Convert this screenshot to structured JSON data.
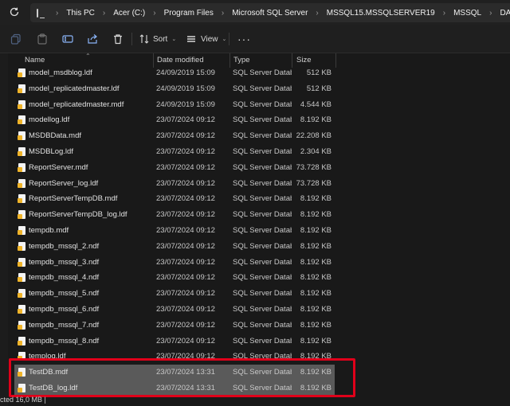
{
  "address_bar": {
    "crumbs": [
      "This PC",
      "Acer (C:)",
      "Program Files",
      "Microsoft SQL Server",
      "MSSQL15.MSSQLSERVER19",
      "MSSQL",
      "DATA"
    ]
  },
  "toolbar": {
    "sort_label": "Sort",
    "view_label": "View"
  },
  "columns": {
    "name": "Name",
    "date": "Date modified",
    "type": "Type",
    "size": "Size"
  },
  "files": [
    {
      "name": "model_msdblog.ldf",
      "date": "24/09/2019 15:09",
      "type": "SQL Server Databa...",
      "size": "512 KB",
      "selected": false
    },
    {
      "name": "model_replicatedmaster.ldf",
      "date": "24/09/2019 15:09",
      "type": "SQL Server Databa...",
      "size": "512 KB",
      "selected": false
    },
    {
      "name": "model_replicatedmaster.mdf",
      "date": "24/09/2019 15:09",
      "type": "SQL Server Databa...",
      "size": "4.544 KB",
      "selected": false
    },
    {
      "name": "modellog.ldf",
      "date": "23/07/2024 09:12",
      "type": "SQL Server Databa...",
      "size": "8.192 KB",
      "selected": false
    },
    {
      "name": "MSDBData.mdf",
      "date": "23/07/2024 09:12",
      "type": "SQL Server Databa...",
      "size": "22.208 KB",
      "selected": false
    },
    {
      "name": "MSDBLog.ldf",
      "date": "23/07/2024 09:12",
      "type": "SQL Server Databa...",
      "size": "2.304 KB",
      "selected": false
    },
    {
      "name": "ReportServer.mdf",
      "date": "23/07/2024 09:12",
      "type": "SQL Server Databa...",
      "size": "73.728 KB",
      "selected": false
    },
    {
      "name": "ReportServer_log.ldf",
      "date": "23/07/2024 09:12",
      "type": "SQL Server Databa...",
      "size": "73.728 KB",
      "selected": false
    },
    {
      "name": "ReportServerTempDB.mdf",
      "date": "23/07/2024 09:12",
      "type": "SQL Server Databa...",
      "size": "8.192 KB",
      "selected": false
    },
    {
      "name": "ReportServerTempDB_log.ldf",
      "date": "23/07/2024 09:12",
      "type": "SQL Server Databa...",
      "size": "8.192 KB",
      "selected": false
    },
    {
      "name": "tempdb.mdf",
      "date": "23/07/2024 09:12",
      "type": "SQL Server Databa...",
      "size": "8.192 KB",
      "selected": false
    },
    {
      "name": "tempdb_mssql_2.ndf",
      "date": "23/07/2024 09:12",
      "type": "SQL Server Databa...",
      "size": "8.192 KB",
      "selected": false
    },
    {
      "name": "tempdb_mssql_3.ndf",
      "date": "23/07/2024 09:12",
      "type": "SQL Server Databa...",
      "size": "8.192 KB",
      "selected": false
    },
    {
      "name": "tempdb_mssql_4.ndf",
      "date": "23/07/2024 09:12",
      "type": "SQL Server Databa...",
      "size": "8.192 KB",
      "selected": false
    },
    {
      "name": "tempdb_mssql_5.ndf",
      "date": "23/07/2024 09:12",
      "type": "SQL Server Databa...",
      "size": "8.192 KB",
      "selected": false
    },
    {
      "name": "tempdb_mssql_6.ndf",
      "date": "23/07/2024 09:12",
      "type": "SQL Server Databa...",
      "size": "8.192 KB",
      "selected": false
    },
    {
      "name": "tempdb_mssql_7.ndf",
      "date": "23/07/2024 09:12",
      "type": "SQL Server Databa...",
      "size": "8.192 KB",
      "selected": false
    },
    {
      "name": "tempdb_mssql_8.ndf",
      "date": "23/07/2024 09:12",
      "type": "SQL Server Databa...",
      "size": "8.192 KB",
      "selected": false
    },
    {
      "name": "templog.ldf",
      "date": "23/07/2024 09:12",
      "type": "SQL Server Databa...",
      "size": "8.192 KB",
      "selected": false
    },
    {
      "name": "TestDB.mdf",
      "date": "23/07/2024 13:31",
      "type": "SQL Server Databa...",
      "size": "8.192 KB",
      "selected": true
    },
    {
      "name": "TestDB_log.ldf",
      "date": "23/07/2024 13:31",
      "type": "SQL Server Databa...",
      "size": "8.192 KB",
      "selected": true
    }
  ],
  "status_bar": {
    "text": "cted  16,0 MB  |"
  },
  "colors": {
    "background": "#191919",
    "selection": "#5a5a5a",
    "highlight_box": "#e0001a",
    "file_icon_accent": "#f0b429"
  },
  "icons": [
    "refresh-icon",
    "this-pc-icon",
    "copy-icon",
    "paste-icon",
    "rename-icon",
    "share-icon",
    "delete-icon",
    "sort-icon",
    "view-icon",
    "more-icon",
    "file-icon"
  ]
}
